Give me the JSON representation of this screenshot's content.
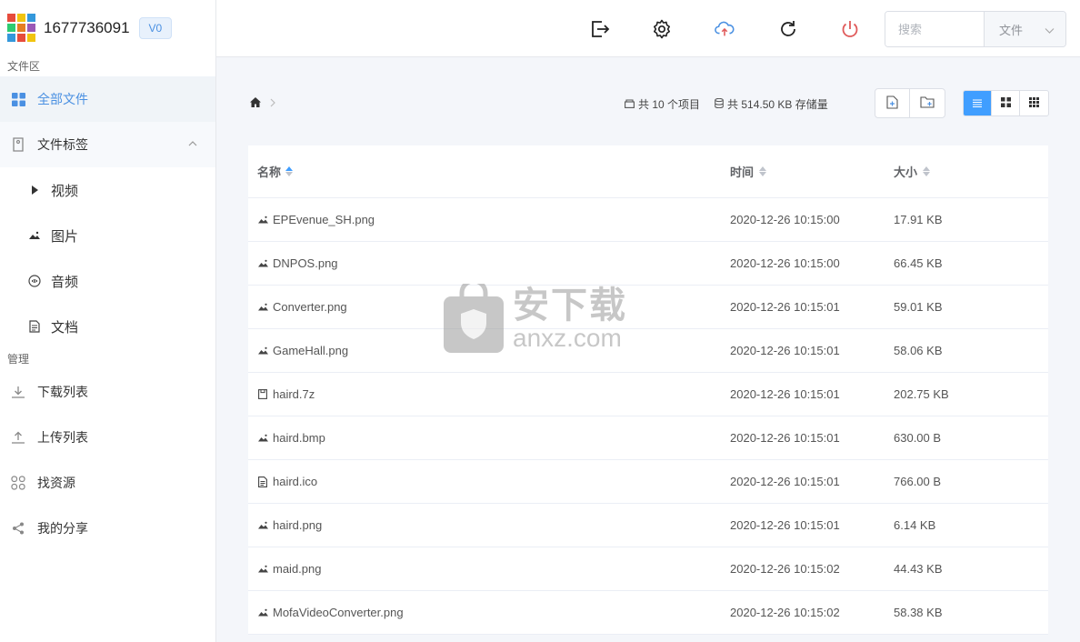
{
  "user": {
    "name": "1677736091",
    "level": "V0"
  },
  "sidebar": {
    "section_files": "文件区",
    "all_files": "全部文件",
    "file_tags": "文件标签",
    "tags": [
      {
        "label": "视频",
        "icon": "play-icon"
      },
      {
        "label": "图片",
        "icon": "image-icon"
      },
      {
        "label": "音频",
        "icon": "audio-icon"
      },
      {
        "label": "文档",
        "icon": "document-icon"
      }
    ],
    "section_manage": "管理",
    "manage_items": [
      {
        "label": "下载列表",
        "icon": "download-icon"
      },
      {
        "label": "上传列表",
        "icon": "upload-icon"
      },
      {
        "label": "找资源",
        "icon": "apps-icon"
      },
      {
        "label": "我的分享",
        "icon": "share-icon"
      }
    ]
  },
  "search": {
    "placeholder": "搜索",
    "scope": "文件"
  },
  "stats": {
    "items": "共 10 个项目",
    "storage": "共 514.50 KB 存储量"
  },
  "table": {
    "headers": {
      "name": "名称",
      "time": "时间",
      "size": "大小"
    },
    "rows": [
      {
        "name": "EPEvenue_SH.png",
        "time": "2020-12-26 10:15:00",
        "size": "17.91 KB",
        "icon": "image-icon"
      },
      {
        "name": "DNPOS.png",
        "time": "2020-12-26 10:15:00",
        "size": "66.45 KB",
        "icon": "image-icon"
      },
      {
        "name": "Converter.png",
        "time": "2020-12-26 10:15:01",
        "size": "59.01 KB",
        "icon": "image-icon"
      },
      {
        "name": "GameHall.png",
        "time": "2020-12-26 10:15:01",
        "size": "58.06 KB",
        "icon": "image-icon"
      },
      {
        "name": "haird.7z",
        "time": "2020-12-26 10:15:01",
        "size": "202.75 KB",
        "icon": "archive-icon"
      },
      {
        "name": "haird.bmp",
        "time": "2020-12-26 10:15:01",
        "size": "630.00 B",
        "icon": "image-icon"
      },
      {
        "name": "haird.ico",
        "time": "2020-12-26 10:15:01",
        "size": "766.00 B",
        "icon": "file-icon"
      },
      {
        "name": "haird.png",
        "time": "2020-12-26 10:15:01",
        "size": "6.14 KB",
        "icon": "image-icon"
      },
      {
        "name": "maid.png",
        "time": "2020-12-26 10:15:02",
        "size": "44.43 KB",
        "icon": "image-icon"
      },
      {
        "name": "MofaVideoConverter.png",
        "time": "2020-12-26 10:15:02",
        "size": "58.38 KB",
        "icon": "image-icon"
      }
    ]
  },
  "watermark": {
    "cn": "安下载",
    "en": "anxz.com"
  },
  "colors": {
    "accent": "#409eff",
    "power": "#e05a5a",
    "upload": "#4a90e2"
  }
}
